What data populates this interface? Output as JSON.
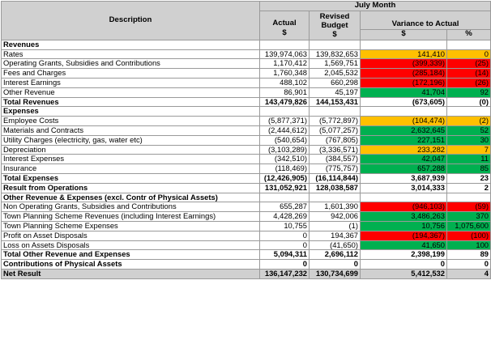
{
  "header": {
    "period": "July Month",
    "description": "Description",
    "actual": "Actual",
    "actual_unit": "$",
    "revised_budget": "Revised Budget",
    "budget_unit": "$",
    "variance": "Variance to Actual",
    "variance_dollar": "$",
    "variance_pct": "%"
  },
  "rows": [
    {
      "kind": "section",
      "desc": "Revenues"
    },
    {
      "kind": "item",
      "desc": "Rates",
      "actual": "139,974,063",
      "budget": "139,832,653",
      "var": "141,410",
      "pct": "0",
      "color": "yellow"
    },
    {
      "kind": "item",
      "desc": "Operating Grants, Subsidies and Contributions",
      "actual": "1,170,412",
      "budget": "1,569,751",
      "var": "(399,339)",
      "pct": "(25)",
      "color": "red"
    },
    {
      "kind": "item",
      "desc": "Fees and Charges",
      "actual": "1,760,348",
      "budget": "2,045,532",
      "var": "(285,184)",
      "pct": "(14)",
      "color": "red"
    },
    {
      "kind": "item",
      "desc": "Interest Earnings",
      "actual": "488,102",
      "budget": "660,298",
      "var": "(172,196)",
      "pct": "(26)",
      "color": "red"
    },
    {
      "kind": "item",
      "desc": "Other Revenue",
      "actual": "86,901",
      "budget": "45,197",
      "var": "41,704",
      "pct": "92",
      "color": "green"
    },
    {
      "kind": "total",
      "desc": "Total Revenues",
      "actual": "143,479,826",
      "budget": "144,153,431",
      "var": "(673,605)",
      "pct": "(0)",
      "color": ""
    },
    {
      "kind": "section",
      "desc": "Expenses"
    },
    {
      "kind": "item",
      "desc": "Employee Costs",
      "actual": "(5,877,371)",
      "budget": "(5,772,897)",
      "var": "(104,474)",
      "pct": "(2)",
      "color": "yellow"
    },
    {
      "kind": "item",
      "desc": "Materials and Contracts",
      "actual": "(2,444,612)",
      "budget": "(5,077,257)",
      "var": "2,632,645",
      "pct": "52",
      "color": "green"
    },
    {
      "kind": "item",
      "desc": "Utility Charges (electricity, gas, water etc)",
      "actual": "(540,654)",
      "budget": "(767,805)",
      "var": "227,151",
      "pct": "30",
      "color": "green"
    },
    {
      "kind": "item",
      "desc": "Depreciation",
      "actual": "(3,103,289)",
      "budget": "(3,336,571)",
      "var": "233,282",
      "pct": "7",
      "color": "yellow"
    },
    {
      "kind": "item",
      "desc": "Interest Expenses",
      "actual": "(342,510)",
      "budget": "(384,557)",
      "var": "42,047",
      "pct": "11",
      "color": "green"
    },
    {
      "kind": "item",
      "desc": "Insurance",
      "actual": "(118,469)",
      "budget": "(775,757)",
      "var": "657,288",
      "pct": "85",
      "color": "green"
    },
    {
      "kind": "total",
      "desc": "Total Expenses",
      "actual": "(12,426,905)",
      "budget": "(16,114,844)",
      "var": "3,687,939",
      "pct": "23",
      "color": ""
    },
    {
      "kind": "total",
      "desc": "Result from Operations",
      "actual": "131,052,921",
      "budget": "128,038,587",
      "var": "3,014,333",
      "pct": "2",
      "color": ""
    },
    {
      "kind": "section",
      "desc": "Other Revenue & Expenses (excl. Contr of Physical Assets)"
    },
    {
      "kind": "item",
      "desc": "Non Operating Grants, Subsidies and Contributions",
      "actual": "655,287",
      "budget": "1,601,390",
      "var": "(946,103)",
      "pct": "(59)",
      "color": "red"
    },
    {
      "kind": "item",
      "desc": "Town Planning Scheme Revenues (including Interest Earnings)",
      "actual": "4,428,269",
      "budget": "942,006",
      "var": "3,486,263",
      "pct": "370",
      "color": "green"
    },
    {
      "kind": "item",
      "desc": "Town Planning Scheme Expenses",
      "actual": "10,755",
      "budget": "(1)",
      "var": "10,756",
      "pct": "1,075,600",
      "color": "green"
    },
    {
      "kind": "item",
      "desc": "Profit on Asset Disposals",
      "actual": "0",
      "budget": "194,367",
      "var": "(194,367)",
      "pct": "(100)",
      "color": "red"
    },
    {
      "kind": "item",
      "desc": "Loss on Assets Disposals",
      "actual": "0",
      "budget": "(41,650)",
      "var": "41,650",
      "pct": "100",
      "color": "green"
    },
    {
      "kind": "total",
      "desc": "Total Other Revenue and Expenses",
      "actual": "5,094,311",
      "budget": "2,696,112",
      "var": "2,398,199",
      "pct": "89",
      "color": ""
    },
    {
      "kind": "total",
      "desc": "Contributions of Physical Assets",
      "actual": "0",
      "budget": "0",
      "var": "0",
      "pct": "0",
      "color": ""
    },
    {
      "kind": "net",
      "desc": "Net Result",
      "actual": "136,147,232",
      "budget": "130,734,699",
      "var": "5,412,532",
      "pct": "4",
      "color": ""
    }
  ],
  "colors": {
    "header_grey": "#d0d0d0",
    "yellow": "#ffc000",
    "red": "#ff0000",
    "green": "#00b050"
  }
}
